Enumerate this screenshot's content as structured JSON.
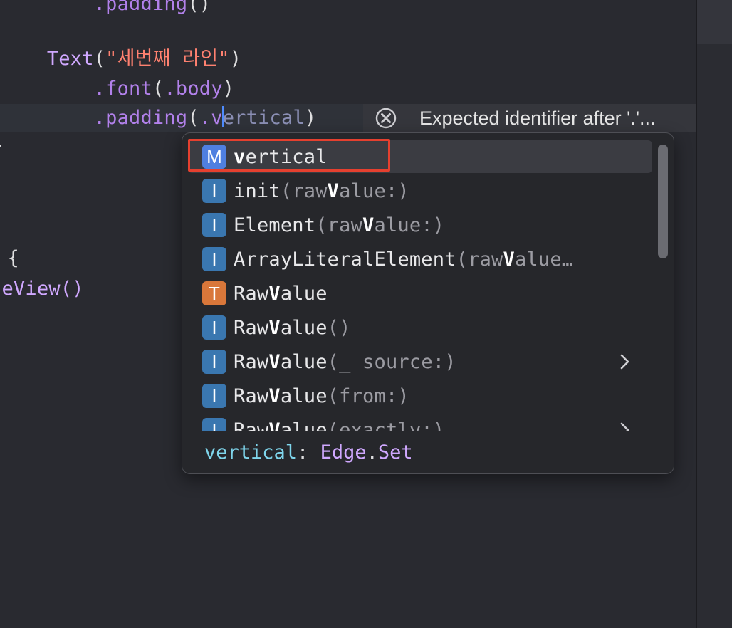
{
  "editor": {
    "lines": [
      {
        "indent": "        ",
        "method": ".padding",
        "plain": "()"
      },
      {
        "indent": "    ",
        "type": "Text",
        "plain_open": "(",
        "string": "\"세번째 라인\"",
        "plain_close": ")"
      },
      {
        "indent": "        ",
        "method": ".font",
        "plain_open": "(",
        "method2": ".body",
        "plain_close": ")"
      },
      {
        "indent": "        ",
        "method": ".padding",
        "plain_open": "(",
        "typed_prefix": ".v",
        "ghost": "ertical",
        "plain_close": ")"
      },
      {
        "text": "}"
      },
      {
        "text": " {"
      },
      {
        "text": "leView()"
      }
    ]
  },
  "error_banner": {
    "icon": "error-circle-x-icon",
    "message": "Expected identifier after '.'..."
  },
  "completion": {
    "items": [
      {
        "kind": "M",
        "match": "v",
        "rest": "ertical",
        "dim": "",
        "selected": true,
        "has_submenu": false
      },
      {
        "kind": "I",
        "pre": "init",
        "dim_open": "(raw",
        "match": "V",
        "dim_close": "alue:)",
        "has_submenu": false
      },
      {
        "kind": "I",
        "pre": "Element",
        "dim_open": "(raw",
        "match": "V",
        "dim_close": "alue:)",
        "has_submenu": false
      },
      {
        "kind": "I",
        "pre": "ArrayLiteralElement",
        "dim_open": "(raw",
        "match": "V",
        "dim_close": "alue…",
        "has_submenu": false
      },
      {
        "kind": "T",
        "pre": "Raw",
        "match": "V",
        "rest": "alue",
        "has_submenu": false
      },
      {
        "kind": "I",
        "pre": "Raw",
        "match": "V",
        "rest": "alue",
        "dim_close": "()",
        "has_submenu": false
      },
      {
        "kind": "I",
        "pre": "Raw",
        "match": "V",
        "rest": "alue",
        "dim_close": "(_ source:)",
        "has_submenu": true
      },
      {
        "kind": "I",
        "pre": "Raw",
        "match": "V",
        "rest": "alue",
        "dim_close": "(from:)",
        "has_submenu": false
      },
      {
        "kind": "I",
        "pre": "Raw",
        "match": "V",
        "rest": "alue",
        "dim_close": "(exactly:)",
        "has_submenu": true
      }
    ],
    "detail": {
      "name": "vertical",
      "sep": ": ",
      "type_a": "Edge",
      "dot": ".",
      "type_b": "Set"
    }
  },
  "colors": {
    "editor_bg": "#292a30",
    "badge_method": "#4f7fe0",
    "badge_initializer": "#3a77b0",
    "badge_type": "#d9773a",
    "highlight_border": "#e5402f"
  }
}
